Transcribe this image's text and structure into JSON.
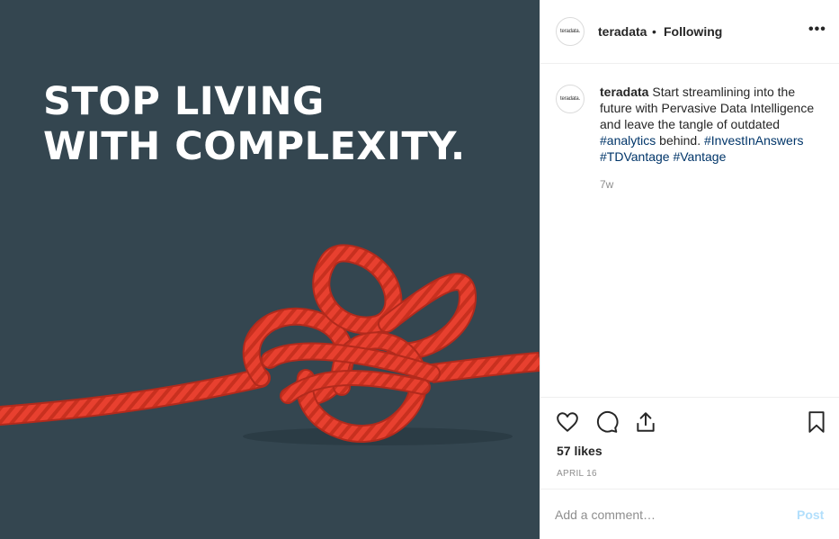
{
  "image": {
    "headline_line1": "STOP LIVING",
    "headline_line2": "WITH COMPLEXITY.",
    "background_color": "#344650",
    "rope_color": "#e8402f"
  },
  "header": {
    "avatar_text": "teradata.",
    "username": "teradata",
    "separator": "•",
    "follow_status": "Following",
    "more_icon": "more-horizontal-icon",
    "more_label": "•••"
  },
  "caption": {
    "avatar_text": "teradata.",
    "username": "teradata",
    "text_1": " Start streamlining into the future with Pervasive Data Intelligence and leave the tangle of outdated ",
    "tag_1": "#analytics",
    "text_2": " behind. ",
    "tag_2": "#InvestInAnswers",
    "text_3": " ",
    "tag_3": "#TDVantage",
    "text_4": " ",
    "tag_4": "#Vantage",
    "time_ago": "7w"
  },
  "actions": {
    "like_icon": "heart-icon",
    "comment_icon": "comment-icon",
    "share_icon": "share-icon",
    "save_icon": "bookmark-icon"
  },
  "likes": "57 likes",
  "date": "APRIL 16",
  "comment": {
    "placeholder": "Add a comment…",
    "post_label": "Post"
  },
  "colors": {
    "hashtag": "#003569",
    "post_disabled": "#b2dffc",
    "muted": "#8e8e8e"
  }
}
